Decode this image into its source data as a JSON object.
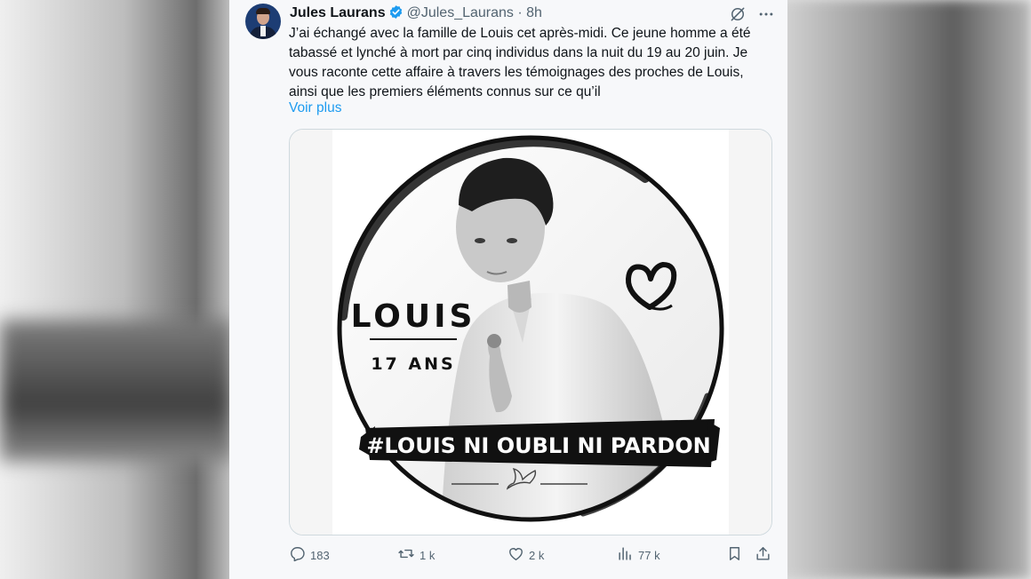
{
  "tweet": {
    "author_name": "Jules Laurans",
    "handle": "@Jules_Laurans",
    "separator": "·",
    "time": "8h",
    "text": "J’ai échangé avec la famille de Louis cet après-midi. Ce jeune homme a été\ntabassé et lynché à mort par cinq individus dans la nuit du 19 au 20 juin. Je\nvous raconte cette affaire à travers les témoignages des proches de Louis,\nainsi que les premiers éléments connus sur ce qu’il",
    "show_more": "Voir plus"
  },
  "media": {
    "name": "LOUIS",
    "age": "17 ANS",
    "hashtag": "#LOUIS NI OUBLI NI PARDON"
  },
  "actions": {
    "replies": "183",
    "reposts": "1 k",
    "likes": "2 k",
    "views": "77 k"
  },
  "colors": {
    "link": "#1d9bf0",
    "verified": "#1d9bf0",
    "muted": "#536471"
  },
  "icons": [
    "verified-badge-icon",
    "grok-icon",
    "more-icon",
    "reply-icon",
    "repost-icon",
    "like-icon",
    "views-icon",
    "bookmark-icon",
    "share-icon",
    "heart-drawing-icon",
    "dove-icon"
  ]
}
